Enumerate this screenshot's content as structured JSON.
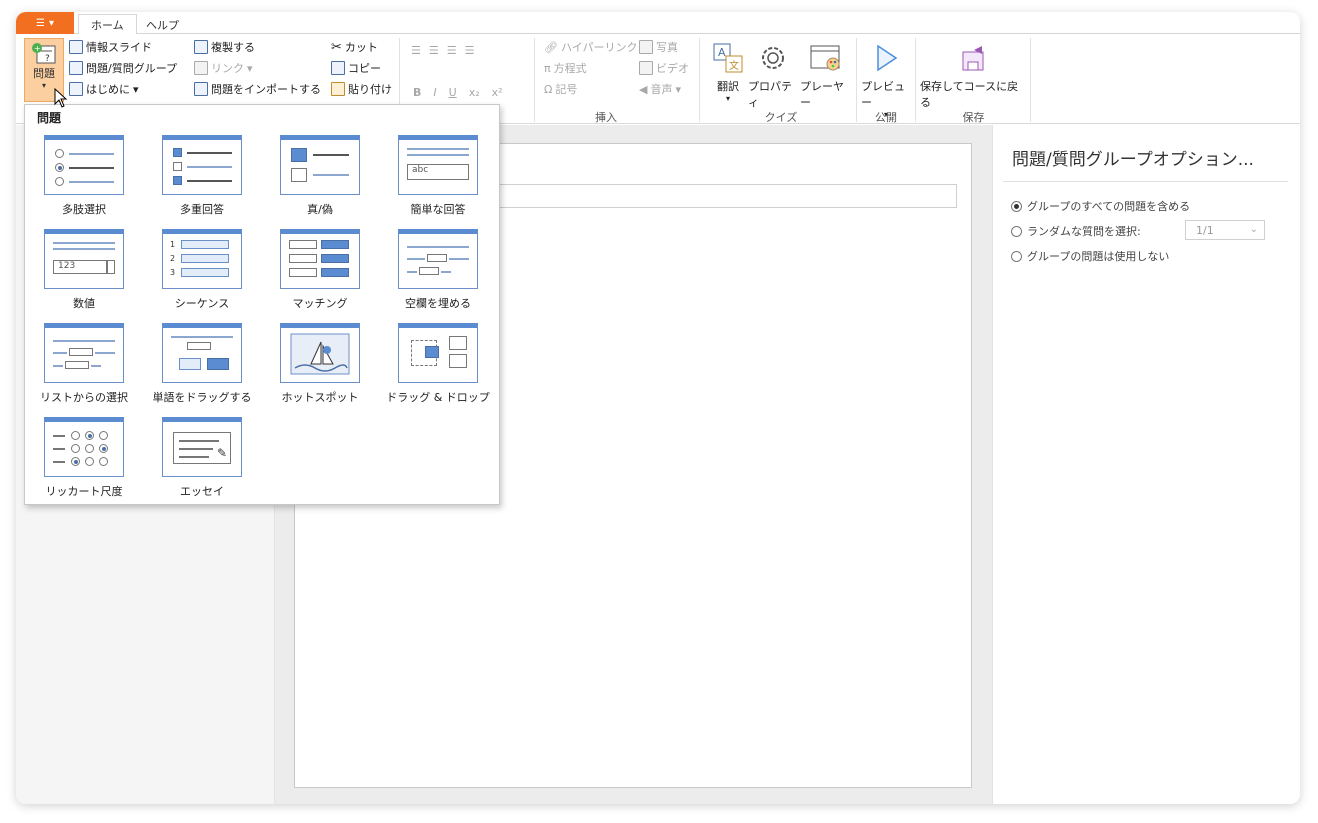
{
  "tabs": {
    "file_icon": "list-icon",
    "items": [
      {
        "label": "ホーム"
      },
      {
        "label": "ヘルプ"
      }
    ]
  },
  "ribbon": {
    "question_label": "問題",
    "info_slide": "情報スライド",
    "question_group": "問題/質問グループ",
    "intro": "はじめに",
    "duplicate": "複製する",
    "link": "リンク",
    "import_questions": "問題をインポートする",
    "cut": "カット",
    "copy": "コピー",
    "paste": "貼り付け",
    "bold": "B",
    "italic": "I",
    "underline": "U",
    "subscript": "x₂",
    "superscript": "x²",
    "hyperlink": "ハイパーリンク",
    "equation": "方程式",
    "symbol": "記号",
    "photo": "写真",
    "video": "ビデオ",
    "audio": "音声",
    "group_insert": "挿入",
    "translate": "翻訳",
    "properties": "プロパティ",
    "player": "プレーヤー",
    "group_quiz": "クイズ",
    "preview": "プレビュー",
    "group_publish": "公開",
    "save_return": "保存してコースに戻る",
    "group_save": "保存"
  },
  "dropdown": {
    "title": "問題",
    "items": [
      {
        "label": "多肢選択"
      },
      {
        "label": "多重回答"
      },
      {
        "label": "真/偽"
      },
      {
        "label": "簡単な回答",
        "thumb_text": "abc"
      },
      {
        "label": "数値",
        "thumb_text": "123"
      },
      {
        "label": "シーケンス",
        "thumb_text": "1 2 3"
      },
      {
        "label": "マッチング"
      },
      {
        "label": "空欄を埋める"
      },
      {
        "label": "リストからの選択"
      },
      {
        "label": "単語をドラッグする"
      },
      {
        "label": "ホットスポット"
      },
      {
        "label": "ドラッグ & ドロップ"
      },
      {
        "label": "リッカート尺度"
      },
      {
        "label": "エッセイ"
      }
    ]
  },
  "right_panel": {
    "title": "問題/質問グループオプション...",
    "options": [
      {
        "label": "グループのすべての問題を含める",
        "selected": true
      },
      {
        "label": "ランダムな質問を選択:",
        "selected": false
      },
      {
        "label": "グループの問題は使用しない",
        "selected": false
      }
    ],
    "random_select_value": "1/1"
  },
  "colors": {
    "accent": "#f26f21",
    "question_btn_bg": "#fbcf9f",
    "thumb_blue": "#5b8bd0"
  }
}
